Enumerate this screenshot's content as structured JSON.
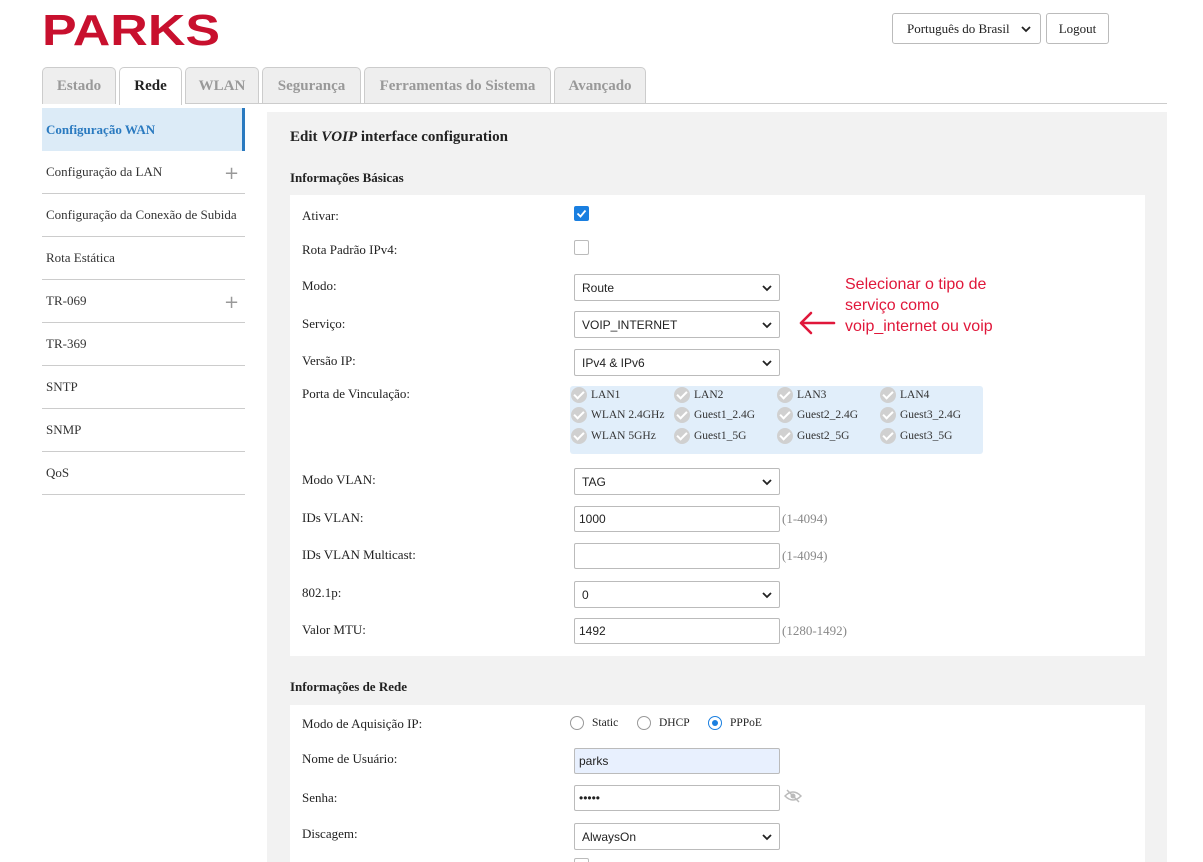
{
  "header": {
    "logo_text": "PARKS",
    "brand_color": "#c8102e",
    "language": "Português do Brasil",
    "logout_label": "Logout"
  },
  "tabs": [
    {
      "label": "Estado",
      "active": false
    },
    {
      "label": "Rede",
      "active": true
    },
    {
      "label": "WLAN",
      "active": false
    },
    {
      "label": "Segurança",
      "active": false
    },
    {
      "label": "Ferramentas do Sistema",
      "active": false
    },
    {
      "label": "Avançado",
      "active": false
    }
  ],
  "sidebar": {
    "items": [
      {
        "label": "Configuração WAN",
        "active": true,
        "expandable": false
      },
      {
        "label": "Configuração da LAN",
        "active": false,
        "expandable": true
      },
      {
        "label": "Configuração da Conexão de Subida",
        "active": false,
        "expandable": false
      },
      {
        "label": "Rota Estática",
        "active": false,
        "expandable": false
      },
      {
        "label": "TR-069",
        "active": false,
        "expandable": true
      },
      {
        "label": "TR-369",
        "active": false,
        "expandable": false
      },
      {
        "label": "SNTP",
        "active": false,
        "expandable": false
      },
      {
        "label": "SNMP",
        "active": false,
        "expandable": false
      },
      {
        "label": "QoS",
        "active": false,
        "expandable": false
      }
    ]
  },
  "main": {
    "title_prefix": "Edit",
    "title_em": "VOIP",
    "title_suffix": "interface configuration",
    "basic": {
      "title": "Informações Básicas",
      "enable_label": "Ativar:",
      "enable_checked": true,
      "default_route_label": "Rota Padrão IPv4:",
      "default_route_checked": false,
      "mode_label": "Modo:",
      "mode_value": "Route",
      "service_label": "Serviço:",
      "service_value": "VOIP_INTERNET",
      "ip_version_label": "Versão IP:",
      "ip_version_value": "IPv4 & IPv6",
      "binding_label": "Porta de Vinculação:",
      "ports": [
        "LAN1",
        "LAN2",
        "LAN3",
        "LAN4",
        "WLAN 2.4GHz",
        "Guest1_2.4G",
        "Guest2_2.4G",
        "Guest3_2.4G",
        "WLAN 5GHz",
        "Guest1_5G",
        "Guest2_5G",
        "Guest3_5G"
      ],
      "vlan_mode_label": "Modo VLAN:",
      "vlan_mode_value": "TAG",
      "vlan_ids_label": "IDs VLAN:",
      "vlan_ids_value": "1000",
      "vlan_ids_hint": "(1-4094)",
      "vlan_multicast_label": "IDs VLAN Multicast:",
      "vlan_multicast_value": "",
      "vlan_multicast_hint": "(1-4094)",
      "p8021_label": "802.1p:",
      "p8021_value": "0",
      "mtu_label": "Valor MTU:",
      "mtu_value": "1492",
      "mtu_hint": "(1280-1492)"
    },
    "network": {
      "title": "Informações de Rede",
      "acq_label": "Modo de Aquisição IP:",
      "acq_options": [
        "Static",
        "DHCP",
        "PPPoE"
      ],
      "acq_selected": "PPPoE",
      "username_label": "Nome de Usuário:",
      "username_value": "parks",
      "password_label": "Senha:",
      "password_value": "•••••",
      "dial_label": "Discagem:",
      "dial_value": "AlwaysOn"
    }
  },
  "annotation": {
    "text": "Selecionar o tipo de serviço como voip_internet ou voip",
    "color": "#e0173a"
  }
}
